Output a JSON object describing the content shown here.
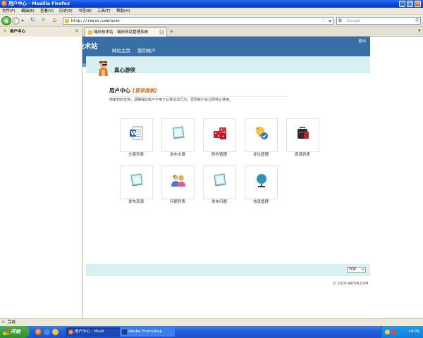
{
  "window": {
    "title": "用户中心 - Mozilla Firefox"
  },
  "menu": [
    "文件(F)",
    "编辑(E)",
    "查看(V)",
    "历史(S)",
    "书签(B)",
    "工具(T)",
    "帮助(H)"
  ],
  "toolbar": {
    "url": "http://raysn.com/user",
    "search_placeholder": "Google",
    "search_engine": "G"
  },
  "sidebar": {
    "title": "用户中心"
  },
  "tabs": [
    {
      "label": "瑞欣技术站 - 瑞欣网站管理系统"
    }
  ],
  "site": {
    "title": "瑞欣技术站",
    "nav": [
      "网站主页",
      "我的帐户"
    ],
    "logout": "退出",
    "username": "真心游侠"
  },
  "user_center": {
    "title": "用户中心",
    "subtitle": "[登录面板]",
    "description": "感谢您的支持，请确保此帐户不用于从事非法行为，否则帐户会立即停止使用。"
  },
  "tiles": [
    {
      "label": "文章列表",
      "icon": "word-document-icon"
    },
    {
      "label": "发布文章",
      "icon": "notepad-icon"
    },
    {
      "label": "附件管理",
      "icon": "dice-icon"
    },
    {
      "label": "评论管理",
      "icon": "comment-bulb-icon"
    },
    {
      "label": "资源列表",
      "icon": "briefcase-icon"
    },
    {
      "label": "发布资源",
      "icon": "notepad-icon"
    },
    {
      "label": "问题列表",
      "icon": "users-icon"
    },
    {
      "label": "发布问题",
      "icon": "notepad-icon"
    },
    {
      "label": "信息管理",
      "icon": "globe-icon"
    }
  ],
  "footer": {
    "top_label": "TOP",
    "copyright": "© 2010 RAYSN.COM"
  },
  "status": {
    "text": "完成"
  },
  "taskbar": {
    "start": "开始",
    "tasks": [
      "用户中心 - Mozil",
      "Adobe Photoshop"
    ],
    "clock": "14:06"
  },
  "colors": {
    "header_blue": "#386ea3",
    "hero_bg": "#d7f0f2",
    "subtitle_orange": "#d2691e"
  }
}
